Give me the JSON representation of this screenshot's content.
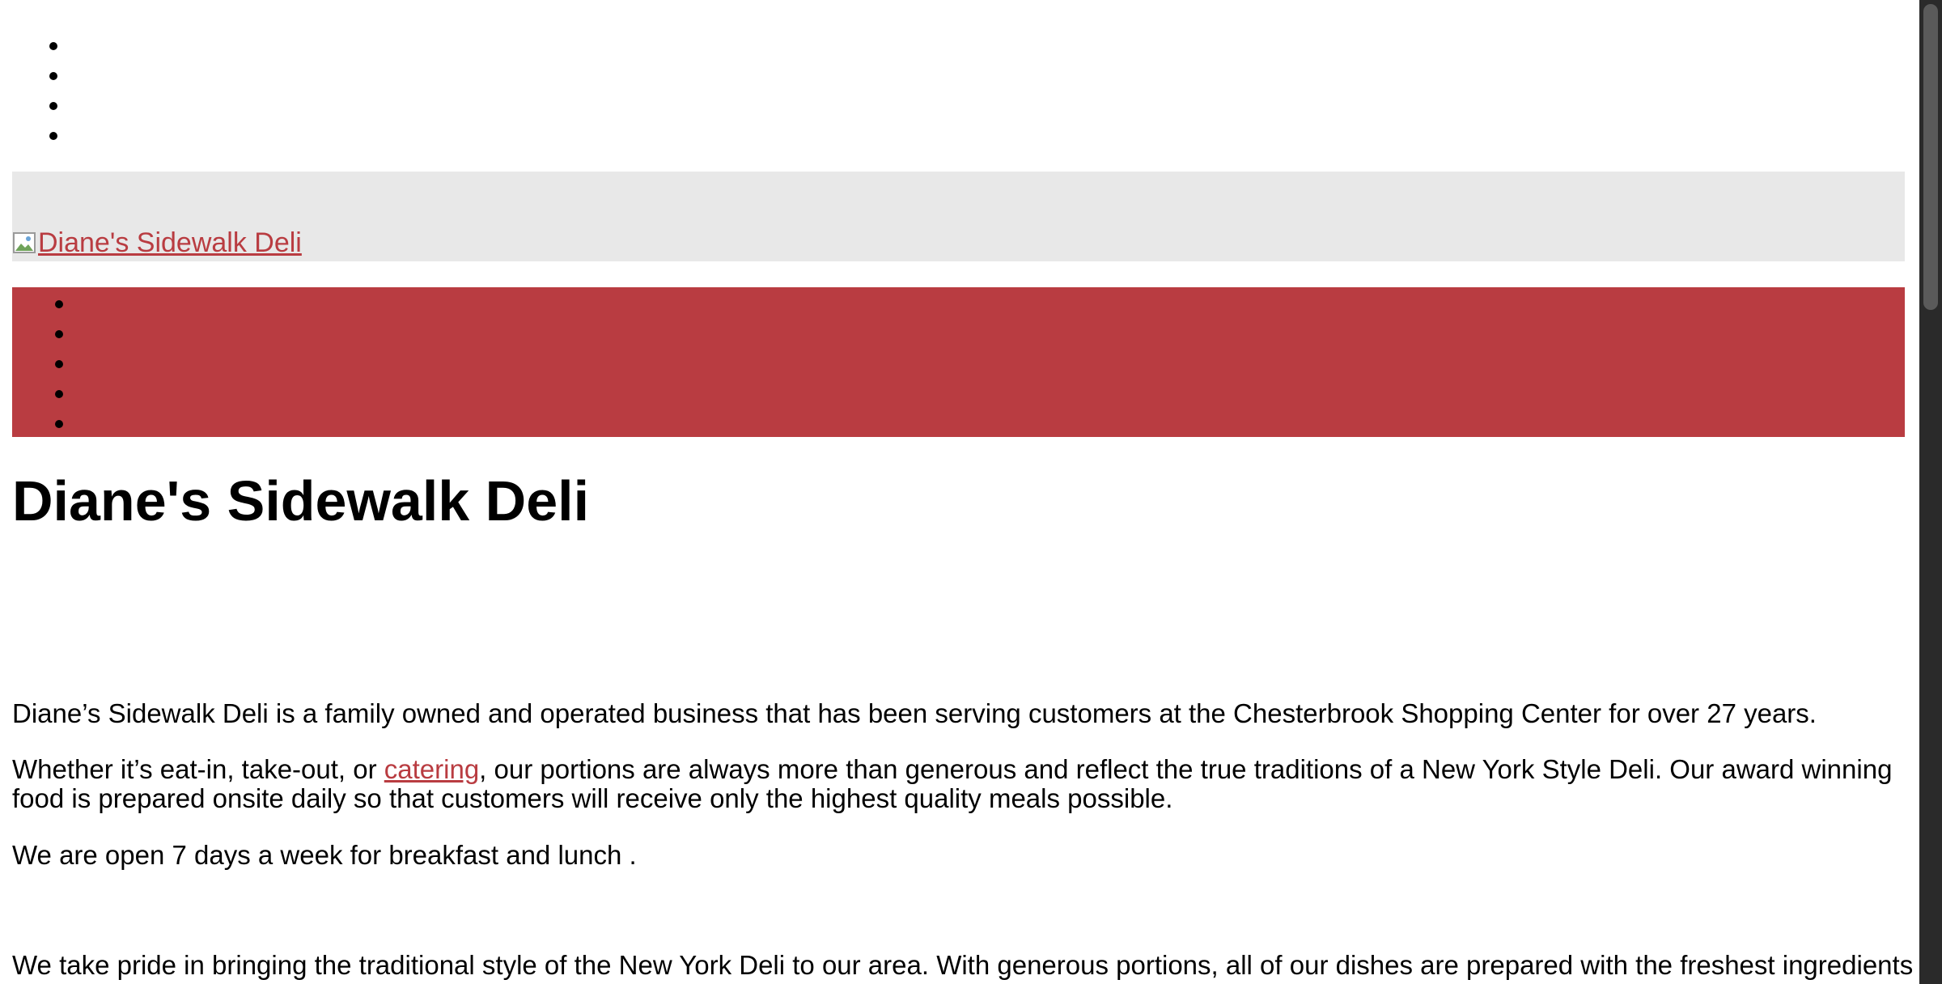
{
  "top_menu": {
    "items": [
      "",
      "",
      "",
      ""
    ]
  },
  "header": {
    "logo_text": "Diane's Sidewalk Deli",
    "logo_icon": "broken-image-icon",
    "band_color": "#e8e8e8"
  },
  "main_nav": {
    "items": [
      "",
      "",
      "",
      "",
      ""
    ],
    "band_color": "#b93c41"
  },
  "page": {
    "title": "Diane's Sidewalk Deli"
  },
  "content": {
    "p1": "Diane’s Sidewalk Deli is a family owned and operated business that has been serving customers at the Chesterbrook Shopping Center for over 27 years.",
    "p2_before": "Whether it’s eat-in, take-out, or ",
    "p2_link": "catering",
    "p2_after": ", our portions are always more than generous and reflect the true traditions of a New York Style Deli. Our award winning food is prepared onsite daily so that customers will receive only the highest quality meals possible.",
    "p3": "We are open 7 days a week for breakfast and lunch .",
    "p4": "We take pride in bringing the traditional style of the New York Deli to our area. With generous portions, all of our dishes are prepared with the freshest ingredients on"
  },
  "colors": {
    "accent": "#b93c41",
    "text": "#000000",
    "background": "#ffffff"
  }
}
